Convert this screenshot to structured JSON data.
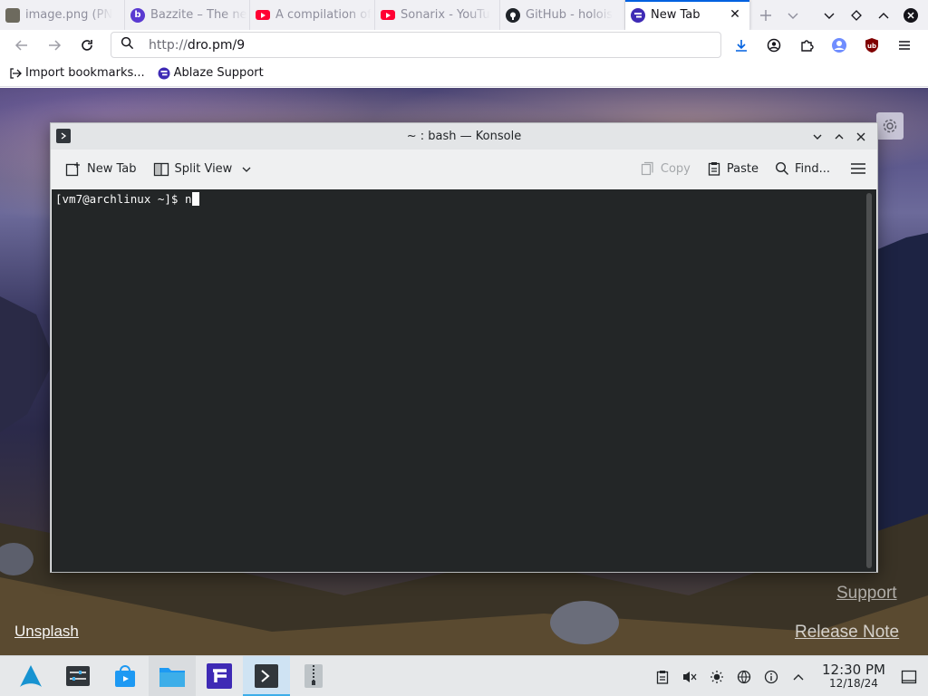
{
  "browser": {
    "tabs": [
      {
        "label": "image.png (PN",
        "favicon": "image-thumbnail-icon",
        "active": false
      },
      {
        "label": "Bazzite – The ne",
        "favicon": "bazzite-logo-icon",
        "active": false
      },
      {
        "label": "A compilation of",
        "favicon": "youtube-icon",
        "active": false
      },
      {
        "label": "Sonarix - YouTu",
        "favicon": "youtube-icon",
        "active": false
      },
      {
        "label": "GitHub - holois",
        "favicon": "github-icon",
        "active": false
      },
      {
        "label": "New Tab",
        "favicon": "firefox-newtab-icon",
        "active": true
      }
    ],
    "url_scheme": "http://",
    "url_rest": "dro.pm/9",
    "bookmarks": [
      {
        "label": "Import bookmarks...",
        "icon": "import-icon"
      },
      {
        "label": "Ablaze Support",
        "icon": "ablaze-icon"
      }
    ]
  },
  "page": {
    "links": {
      "support": "Support",
      "release_note": "Release Note",
      "unsplash": "Unsplash"
    }
  },
  "konsole": {
    "title": "~ : bash — Konsole",
    "toolbar": {
      "new_tab": "New Tab",
      "split_view": "Split View",
      "copy": "Copy",
      "paste": "Paste",
      "find": "Find..."
    },
    "terminal_prompt": "[vm7@archlinux ~]$ n"
  },
  "taskbar": {
    "time": "12:30 PM",
    "date": "12/18/24"
  },
  "colors": {
    "accent": "#0061e0",
    "youtube": "#ff0033",
    "konsole_bg": "#232627",
    "breeze_blue": "#3daee9"
  }
}
